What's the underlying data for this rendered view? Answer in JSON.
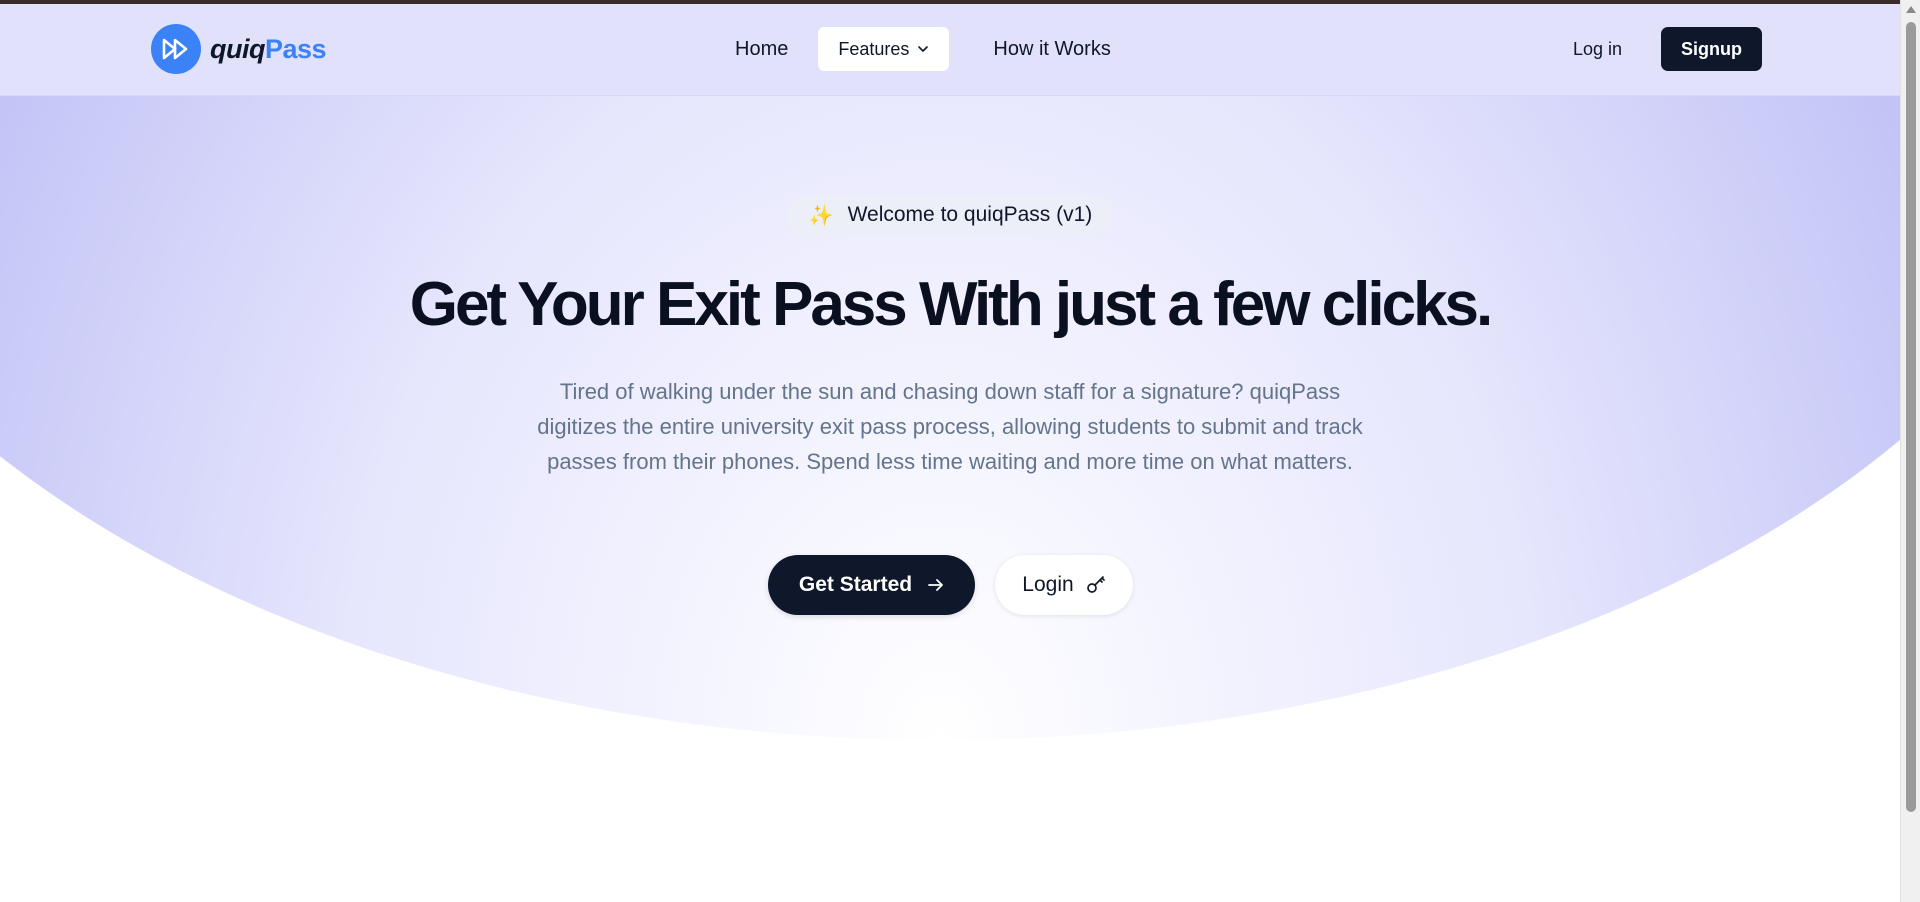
{
  "nav": {
    "logo_part1": "quiq",
    "logo_part2": "Pass",
    "links": {
      "home": "Home",
      "features": "Features",
      "how_it_works": "How it Works"
    },
    "login": "Log in",
    "signup": "Signup"
  },
  "hero": {
    "badge_icon": "✨",
    "badge_text": "Welcome to quiqPass (v1)",
    "headline": "Get Your Exit Pass With just a few clicks.",
    "description": "Tired of walking under the sun and chasing down staff for a signature? quiqPass digitizes the entire university exit pass process, allowing students to submit and track passes from their phones. Spend less time waiting and more time on what matters.",
    "cta_primary": "Get Started",
    "cta_secondary": "Login"
  },
  "colors": {
    "brand_blue": "#3b82f6",
    "dark": "#0f172a",
    "nav_bg": "#e1e1fb"
  },
  "icons": {
    "logo": "fast-forward-icon",
    "features": "chevron-down-icon",
    "cta_primary": "arrow-right-icon",
    "cta_secondary": "key-icon",
    "badge": "sparkles-icon"
  }
}
